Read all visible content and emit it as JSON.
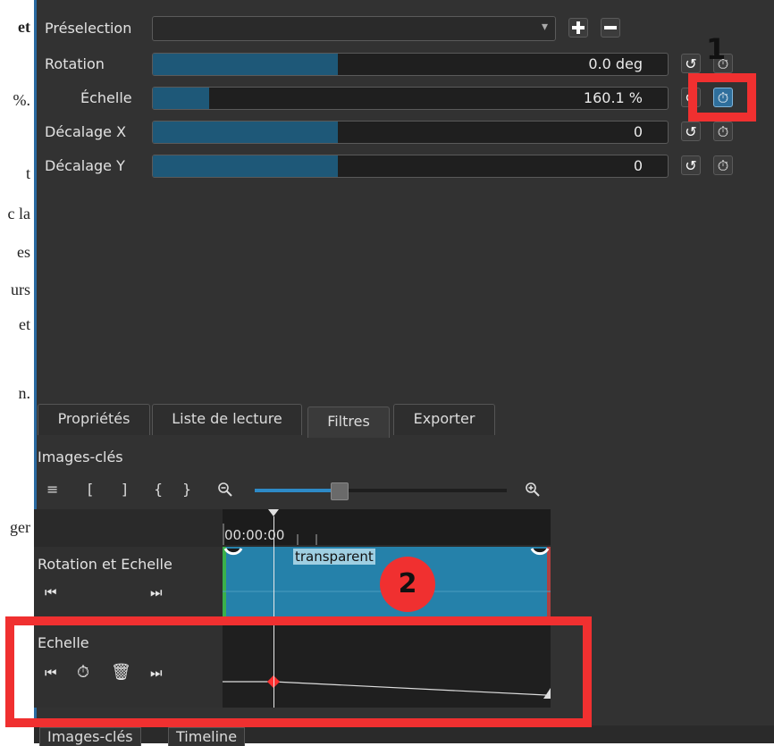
{
  "left_document": {
    "fragments": [
      "et",
      "%.",
      "t",
      "c la",
      "es",
      "urs",
      "et",
      "n.",
      "ger"
    ]
  },
  "filter_panel": {
    "preset_label": "Préselection",
    "preset_value": "",
    "params": [
      {
        "label": "Rotation",
        "value": "0.0 deg",
        "fill_fraction": 0.36
      },
      {
        "label": "Échelle",
        "value": "160.1 %",
        "fill_fraction": 0.11
      },
      {
        "label": "Décalage X",
        "value": "0",
        "fill_fraction": 0.36
      },
      {
        "label": "Décalage Y",
        "value": "0",
        "fill_fraction": 0.36
      }
    ],
    "icons": {
      "add": "plus-icon",
      "remove": "minus-icon",
      "reset": "reset-icon",
      "keyframe": "stopwatch-icon"
    }
  },
  "tabs": [
    {
      "label": "Propriétés",
      "selected": false
    },
    {
      "label": "Liste de lecture",
      "selected": false
    },
    {
      "label": "Filtres",
      "selected": true
    },
    {
      "label": "Exporter",
      "selected": false
    }
  ],
  "keyframes_panel": {
    "title": "Images-clés",
    "toolbar": {
      "menu": "≡",
      "in": "[",
      "out": "]",
      "open": "{",
      "close": "}",
      "zoom_level": 0.34
    },
    "timecode": "00:00:00",
    "tracks": [
      {
        "name": "Rotation et Echelle",
        "clip_label": "transparent"
      },
      {
        "name": "Echelle"
      }
    ]
  },
  "bottom_tabs": [
    {
      "label": "Images-clés"
    },
    {
      "label": "Timeline"
    }
  ],
  "annotations": {
    "one": "1",
    "two": "2"
  },
  "colors": {
    "accent": "#2581aa",
    "highlight_red": "#f03030",
    "panel_bg": "#323232"
  }
}
